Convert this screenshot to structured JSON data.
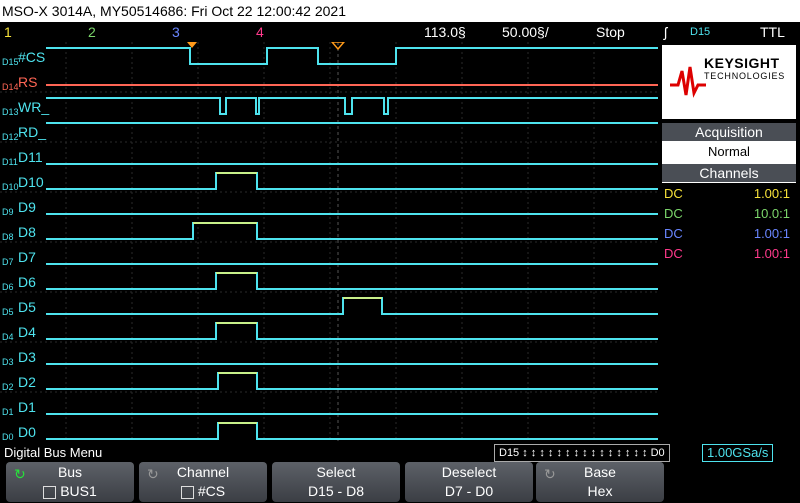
{
  "title": "MSO-X 3014A, MY50514686: Fri Oct 22 12:00:42 2021",
  "status": {
    "ch1": "1",
    "ch2": "2",
    "ch3": "3",
    "ch4": "4",
    "timebase": "113.0§",
    "delay": "50.00§/",
    "run_state": "Stop",
    "trigger_symbol": "ʃ",
    "trigger_source": "D15",
    "trigger_level": "TTL"
  },
  "colors": {
    "ch1": "#f7e23a",
    "ch2": "#7cd66b",
    "ch3": "#6a86ff",
    "ch4": "#ff3a8c",
    "digital": "#4ee3ee",
    "d14": "#ff6655",
    "grid": "#2a2a2a"
  },
  "channels": [
    {
      "label": "D15",
      "name": "#CS",
      "color": "#4ee3ee"
    },
    {
      "label": "D14",
      "name": "RS",
      "color": "#ff6655"
    },
    {
      "label": "D13",
      "name": "WR_",
      "color": "#4ee3ee"
    },
    {
      "label": "D12",
      "name": "RD_",
      "color": "#4ee3ee"
    },
    {
      "label": "D11",
      "name": "D11",
      "color": "#4ee3ee"
    },
    {
      "label": "D10",
      "name": "D10",
      "color": "#4ee3ee"
    },
    {
      "label": "D9",
      "name": "D9",
      "color": "#4ee3ee"
    },
    {
      "label": "D8",
      "name": "D8",
      "color": "#4ee3ee"
    },
    {
      "label": "D7",
      "name": "D7",
      "color": "#4ee3ee"
    },
    {
      "label": "D6",
      "name": "D6",
      "color": "#4ee3ee"
    },
    {
      "label": "D5",
      "name": "D5",
      "color": "#4ee3ee"
    },
    {
      "label": "D4",
      "name": "D4",
      "color": "#4ee3ee"
    },
    {
      "label": "D3",
      "name": "D3",
      "color": "#4ee3ee"
    },
    {
      "label": "D2",
      "name": "D2",
      "color": "#4ee3ee"
    },
    {
      "label": "D1",
      "name": "D1",
      "color": "#4ee3ee"
    },
    {
      "label": "D0",
      "name": "D0",
      "color": "#4ee3ee"
    }
  ],
  "side": {
    "brand_top": "KEYSIGHT",
    "brand_bottom": "TECHNOLOGIES",
    "acquisition_title": "Acquisition",
    "acquisition_mode": "Normal",
    "acquisition_rate": "1.00GSa/s",
    "channels_title": "Channels",
    "channel_rows": [
      {
        "coupling": "DC",
        "probe": "1.00:1",
        "color": "#f7e23a"
      },
      {
        "coupling": "DC",
        "probe": "10.0:1",
        "color": "#7cd66b"
      },
      {
        "coupling": "DC",
        "probe": "1.00:1",
        "color": "#6a86ff"
      },
      {
        "coupling": "DC",
        "probe": "1.00:1",
        "color": "#ff3a8c"
      }
    ]
  },
  "menu": {
    "title": "Digital Bus Menu",
    "bus_pattern": "D15 ↕ ↕ ↕ ↕ ↕ ↕ ↕ ↕ ↕ ↕ ↕ ↕ ↕ ↕ ↕ D0",
    "sample_rate": "1.00GSa/s"
  },
  "softkeys": [
    {
      "label": "Bus",
      "value": "BUS1",
      "check": true,
      "cycle": true
    },
    {
      "label": "Channel",
      "value": "#CS",
      "check": true,
      "cycle": true
    },
    {
      "label": "Select",
      "value": "D15 - D8",
      "check": false,
      "cycle": false
    },
    {
      "label": "Deselect",
      "value": "D7 - D0",
      "check": false,
      "cycle": false
    },
    {
      "label": "Base",
      "value": "Hex",
      "check": false,
      "cycle": true
    }
  ]
}
